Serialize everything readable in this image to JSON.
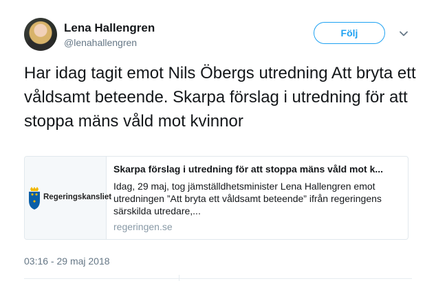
{
  "author": {
    "display_name": "Lena Hallengren",
    "username": "@lenahallengren"
  },
  "follow_label": "Följ",
  "tweet": {
    "text": "Har idag tagit emot Nils Öbergs utredning Att bryta ett våldsamt beteende. Skarpa förslag i utredning för att stoppa mäns våld mot kvinnor",
    "timestamp": "03:16 - 29 maj 2018"
  },
  "card": {
    "brand": "Regeringskansliet",
    "title": "Skarpa förslag i utredning för att stoppa mäns våld mot k...",
    "description": "Idag, 29 maj, tog jämställdhetsminister Lena Hallengren emot utredningen ”Att bryta ett våldsamt beteende” ifrån regeringens särskilda utredare,...",
    "domain": "regeringen.se"
  },
  "icons": {
    "caret": "chevron-down-icon",
    "crest": "crest-icon"
  },
  "colors": {
    "accent": "#1da1f2",
    "muted": "#657786",
    "border": "#e1e8ed"
  }
}
